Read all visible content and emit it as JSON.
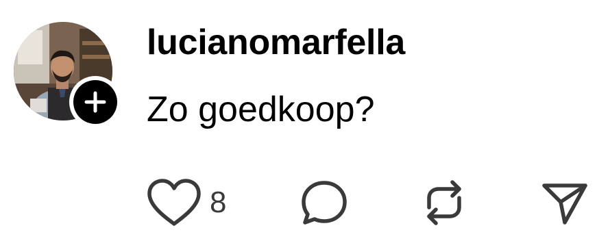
{
  "post": {
    "username": "lucianomarfella",
    "comment": "Zo goedkoop?",
    "avatar_icon": "user-avatar-photo",
    "follow_icon": "plus-icon"
  },
  "actions": {
    "like_icon": "heart-icon",
    "like_count": "8",
    "reply_icon": "speech-bubble-icon",
    "repost_icon": "repost-arrows-icon",
    "share_icon": "paper-plane-icon"
  },
  "colors": {
    "text": "#000000",
    "icon": "#3a3a3a",
    "badge": "#000000"
  }
}
